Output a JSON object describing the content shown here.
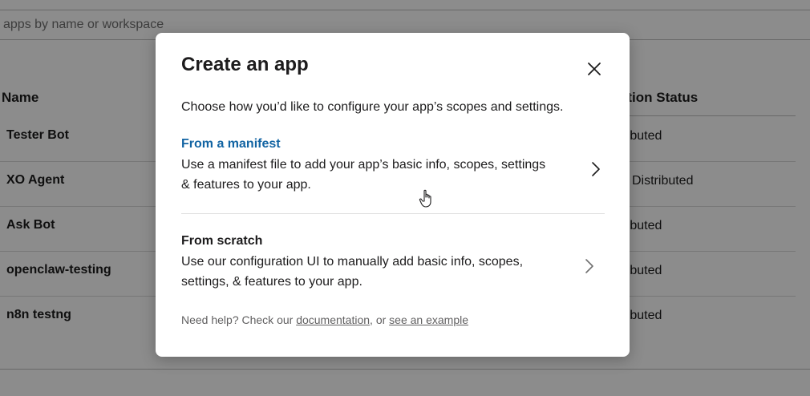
{
  "search": {
    "placeholder": "apps by name or workspace"
  },
  "table": {
    "headers": {
      "name": "Name",
      "status": "ution Status"
    },
    "rows": [
      {
        "name": "Tester Bot",
        "status": "tributed"
      },
      {
        "name": "XO Agent",
        "status": "Distributed"
      },
      {
        "name": "Ask Bot",
        "status": "tributed"
      },
      {
        "name": "openclaw-testing",
        "status": "tributed"
      },
      {
        "name": "n8n testng",
        "status": "tributed"
      }
    ]
  },
  "modal": {
    "title": "Create an app",
    "description": "Choose how you’d like to configure your app’s scopes and settings.",
    "options": [
      {
        "title": "From a manifest",
        "body": "Use a manifest file to add your app’s basic info, scopes, settings & features to your app.",
        "icon": "chevron-right-icon"
      },
      {
        "title": "From scratch",
        "body": "Use our configuration UI to manually add basic info, scopes, settings, & features to your app.",
        "icon": "chevron-right-icon"
      }
    ],
    "help": {
      "prefix": "Need help? Check our ",
      "documentation_link": "documentation",
      "middle": ", or ",
      "example_link": "see an example"
    },
    "close_icon": "close-icon"
  },
  "colors": {
    "link_blue": "#1264a3",
    "overlay": "rgba(0,0,0,0.45)",
    "text": "#1d1c1d"
  }
}
